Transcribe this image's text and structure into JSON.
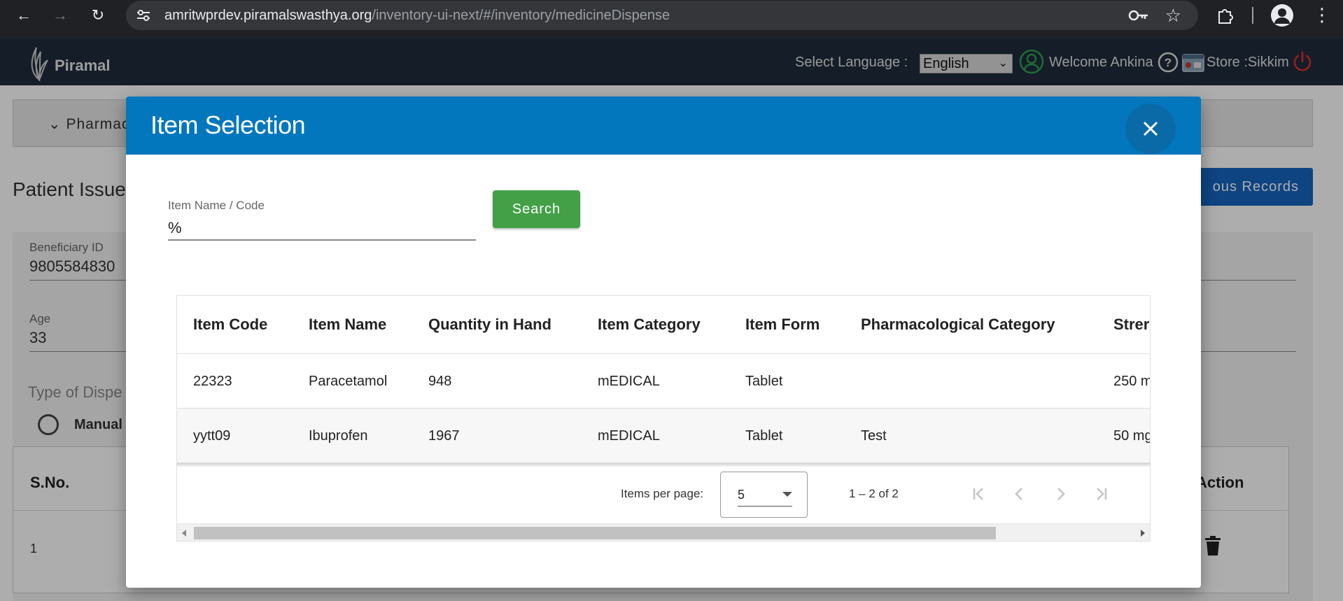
{
  "browser": {
    "url_domain": "amritwprdev.piramalswasthya.org",
    "url_path": "/inventory-ui-next/#/inventory/medicineDispense"
  },
  "header": {
    "logo_text": "Piramal",
    "select_language_label": "Select Language :",
    "language_value": "English",
    "welcome_text": "Welcome Ankina",
    "store_text": "Store :Sikkim"
  },
  "background": {
    "pharmacy_tab": "Pharmac",
    "page_title": "Patient Issue",
    "previous_records_button": "ous Records",
    "beneficiary_id_label": "Beneficiary ID",
    "beneficiary_id_value": "9805584830",
    "age_label": "Age",
    "age_value": "33",
    "type_of_dispense_label": "Type of Dispe",
    "manual_label": "Manual",
    "col_sno": "S.No.",
    "col_action": "Action",
    "row_sno": "1"
  },
  "modal": {
    "title": "Item Selection",
    "search_field_label": "Item Name / Code",
    "search_field_value": "%",
    "search_button": "Search",
    "columns": [
      "Item Code",
      "Item Name",
      "Quantity in Hand",
      "Item Category",
      "Item Form",
      "Pharmacological Category",
      "Strer"
    ],
    "rows": [
      [
        "22323",
        "Paracetamol",
        "948",
        "mEDICAL",
        "Tablet",
        "",
        "250 m"
      ],
      [
        "yytt09",
        "Ibuprofen",
        "1967",
        "mEDICAL",
        "Tablet",
        "Test",
        "50 mg"
      ]
    ],
    "items_per_page_label": "Items per page:",
    "items_per_page_value": "5",
    "range_label": "1 – 2 of 2"
  },
  "colors": {
    "modal_header": "#0277bd",
    "search_button": "#43a047",
    "app_header": "#1e2c3c"
  }
}
